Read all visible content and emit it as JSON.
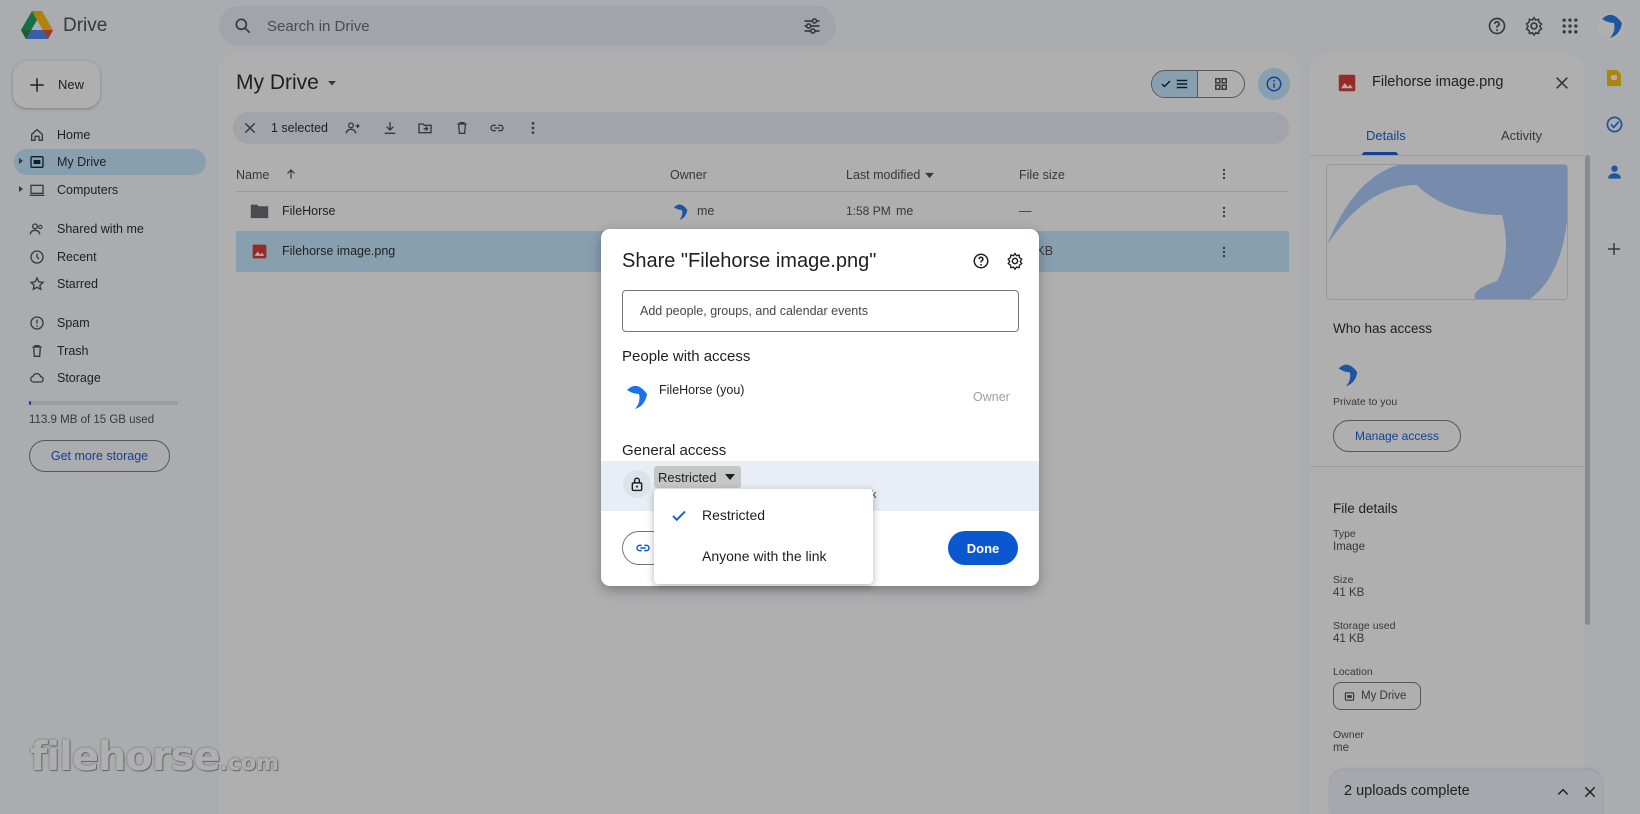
{
  "header": {
    "app_name": "Drive",
    "search_placeholder": "Search in Drive"
  },
  "sidebar": {
    "new_label": "New",
    "items": [
      {
        "label": "Home"
      },
      {
        "label": "My Drive"
      },
      {
        "label": "Computers"
      },
      {
        "label": "Shared with me"
      },
      {
        "label": "Recent"
      },
      {
        "label": "Starred"
      },
      {
        "label": "Spam"
      },
      {
        "label": "Trash"
      },
      {
        "label": "Storage"
      }
    ],
    "storage_text": "113.9 MB of 15 GB used",
    "storage_fraction": 0.0074,
    "get_storage_label": "Get more storage"
  },
  "main": {
    "title": "My Drive",
    "selection_text": "1 selected",
    "columns": {
      "name": "Name",
      "owner": "Owner",
      "modified": "Last modified",
      "size": "File size"
    },
    "rows": [
      {
        "name": "FileHorse",
        "owner": "me",
        "modified": "1:58 PM",
        "modified_by": "me",
        "size": "—"
      },
      {
        "name": "Filehorse image.png",
        "owner": "",
        "modified": "",
        "modified_by": "",
        "size": "41 KB"
      }
    ]
  },
  "details": {
    "title": "Filehorse image.png",
    "tabs": [
      "Details",
      "Activity"
    ],
    "who_has_access": "Who has access",
    "private_text": "Private to you",
    "manage_access": "Manage access",
    "file_details": "File details",
    "type_label": "Type",
    "type_value": "Image",
    "size_label": "Size",
    "size_value": "41 KB",
    "storage_label": "Storage used",
    "storage_value": "41 KB",
    "location_label": "Location",
    "location_value": "My Drive",
    "owner_label": "Owner",
    "owner_value": "me"
  },
  "uploads": {
    "text": "2 uploads complete"
  },
  "watermark": {
    "main": "filehorse",
    "suffix": ".com"
  },
  "dialog": {
    "title": "Share \"Filehorse image.png\"",
    "add_placeholder": "Add people, groups, and calendar events",
    "people_heading": "People with access",
    "person_name": "FileHorse (you)",
    "person_role": "Owner",
    "general_heading": "General access",
    "access_value": "Restricted",
    "link_fragment": "k",
    "done_label": "Done"
  },
  "access_menu": {
    "options": [
      "Restricted",
      "Anyone with the link"
    ],
    "selected_index": 0
  },
  "colors": {
    "accent": "#0b57d0",
    "selected": "#c2e7ff"
  }
}
